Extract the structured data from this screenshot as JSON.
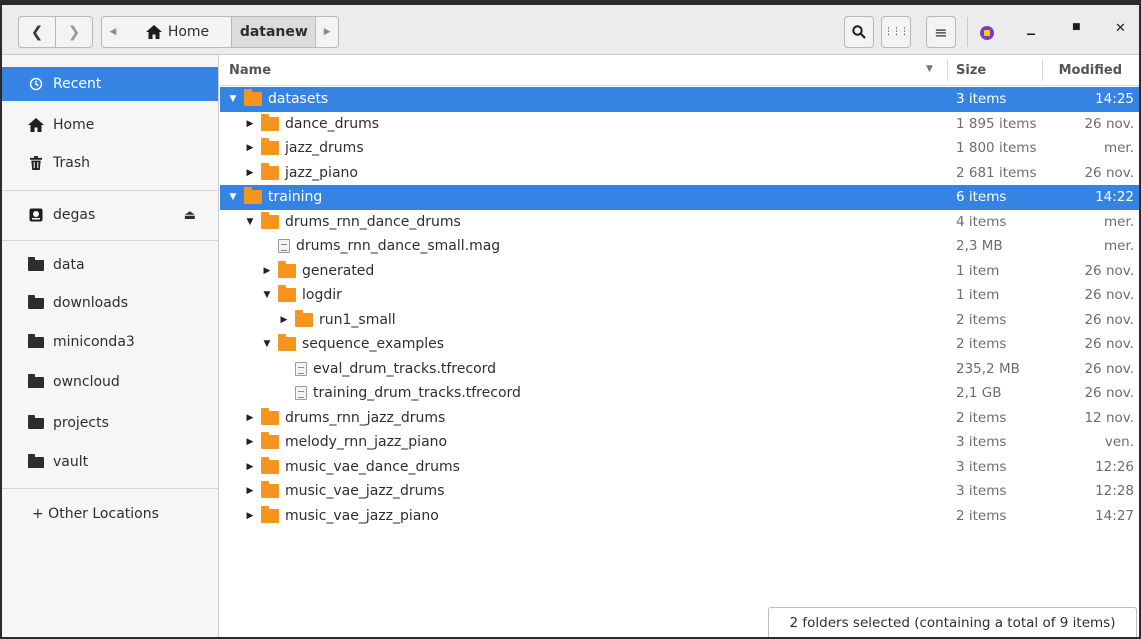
{
  "header": {
    "back_glyph": "❮",
    "forward_glyph": "❯",
    "path_left_arrow": "◀",
    "path_home_label": "Home",
    "path_current": "datanew",
    "path_right_arrow": "▶",
    "search_glyph": "🔍",
    "grid_glyph": "⋮⋮⋮",
    "menu_glyph": "≡",
    "minimize_glyph": "_",
    "maximize_glyph": "■",
    "close_glyph": "✕"
  },
  "sidebar": {
    "recent": "Recent",
    "home": "Home",
    "trash": "Trash",
    "device": "degas",
    "bookmarks": [
      "data",
      "downloads",
      "miniconda3",
      "owncloud",
      "projects",
      "vault"
    ],
    "other_locations": "+ Other Locations",
    "accent_color": "#3584e4"
  },
  "columns": {
    "name": "Name",
    "size": "Size",
    "modified": "Modified"
  },
  "rows": [
    {
      "name": "datasets",
      "type": "folder",
      "level": 0,
      "expanded": true,
      "selected": true,
      "size": "3 items",
      "modified": "14:25"
    },
    {
      "name": "dance_drums",
      "type": "folder",
      "level": 1,
      "expanded": false,
      "selected": false,
      "size": "1 895 items",
      "modified": "26 nov."
    },
    {
      "name": "jazz_drums",
      "type": "folder",
      "level": 1,
      "expanded": false,
      "selected": false,
      "size": "1 800 items",
      "modified": "mer."
    },
    {
      "name": "jazz_piano",
      "type": "folder",
      "level": 1,
      "expanded": false,
      "selected": false,
      "size": "2 681 items",
      "modified": "26 nov."
    },
    {
      "name": "training",
      "type": "folder",
      "level": 0,
      "expanded": true,
      "selected": true,
      "size": "6 items",
      "modified": "14:22"
    },
    {
      "name": "drums_rnn_dance_drums",
      "type": "folder",
      "level": 1,
      "expanded": true,
      "selected": false,
      "size": "4 items",
      "modified": "mer."
    },
    {
      "name": "drums_rnn_dance_small.mag",
      "type": "file",
      "level": 2,
      "expanded": false,
      "selected": false,
      "size": "2,3 MB",
      "modified": "mer."
    },
    {
      "name": "generated",
      "type": "folder",
      "level": 2,
      "expanded": false,
      "selected": false,
      "size": "1 item",
      "modified": "26 nov."
    },
    {
      "name": "logdir",
      "type": "folder",
      "level": 2,
      "expanded": true,
      "selected": false,
      "size": "1 item",
      "modified": "26 nov."
    },
    {
      "name": "run1_small",
      "type": "folder",
      "level": 3,
      "expanded": false,
      "selected": false,
      "size": "2 items",
      "modified": "26 nov."
    },
    {
      "name": "sequence_examples",
      "type": "folder",
      "level": 2,
      "expanded": true,
      "selected": false,
      "size": "2 items",
      "modified": "26 nov."
    },
    {
      "name": "eval_drum_tracks.tfrecord",
      "type": "file",
      "level": 3,
      "expanded": false,
      "selected": false,
      "size": "235,2 MB",
      "modified": "26 nov."
    },
    {
      "name": "training_drum_tracks.tfrecord",
      "type": "file",
      "level": 3,
      "expanded": false,
      "selected": false,
      "size": "2,1 GB",
      "modified": "26 nov."
    },
    {
      "name": "drums_rnn_jazz_drums",
      "type": "folder",
      "level": 1,
      "expanded": false,
      "selected": false,
      "size": "2 items",
      "modified": "12 nov."
    },
    {
      "name": "melody_rnn_jazz_piano",
      "type": "folder",
      "level": 1,
      "expanded": false,
      "selected": false,
      "size": "3 items",
      "modified": "ven."
    },
    {
      "name": "music_vae_dance_drums",
      "type": "folder",
      "level": 1,
      "expanded": false,
      "selected": false,
      "size": "3 items",
      "modified": "12:26"
    },
    {
      "name": "music_vae_jazz_drums",
      "type": "folder",
      "level": 1,
      "expanded": false,
      "selected": false,
      "size": "3 items",
      "modified": "12:28"
    },
    {
      "name": "music_vae_jazz_piano",
      "type": "folder",
      "level": 1,
      "expanded": false,
      "selected": false,
      "size": "2 items",
      "modified": "14:27"
    }
  ],
  "status": "2 folders selected  (containing a total of 9 items)"
}
